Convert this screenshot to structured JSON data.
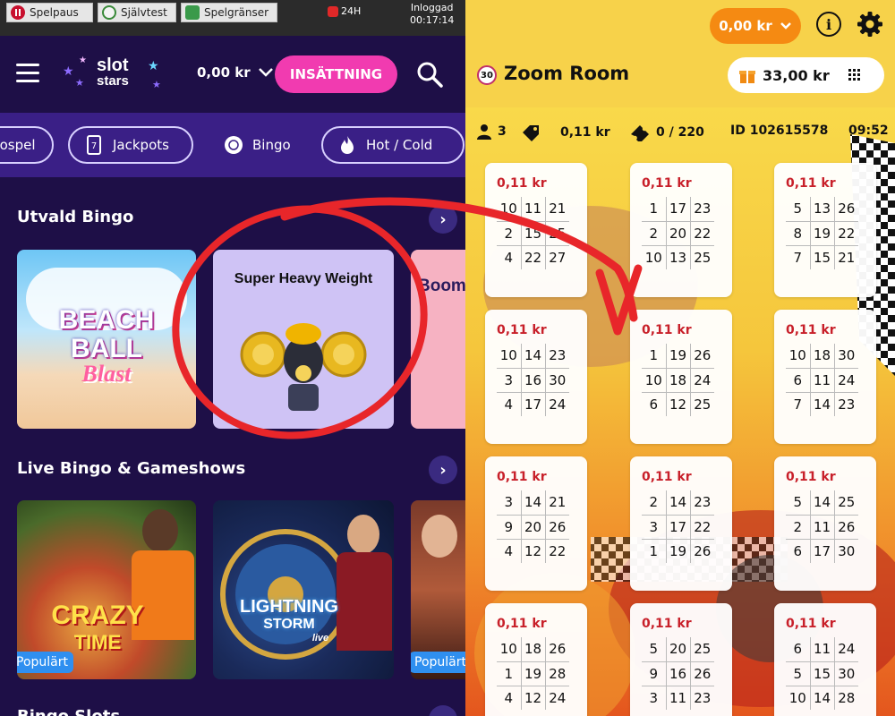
{
  "sysbar": {
    "pause_label": "Spelpaus",
    "selftest_label": "Självtest",
    "limits_label": "Spelgränser",
    "timer_label": "24H",
    "login_label": "Inloggad",
    "login_time": "00:17:14"
  },
  "header": {
    "logo_line1": "slot",
    "logo_line2": "stars",
    "balance": "0,00 kr",
    "deposit_label": "INSÄTTNING"
  },
  "categories": [
    {
      "label": "Gospel",
      "icon": "partial-chip"
    },
    {
      "label": "Jackpots",
      "icon": "jackpot-icon"
    },
    {
      "label": "Bingo",
      "icon": "bingo-ball-icon"
    },
    {
      "label": "Hot / Cold",
      "icon": "fire-icon"
    }
  ],
  "sections": {
    "featured_title": "Utvald Bingo",
    "live_title": "Live Bingo & Gameshows",
    "next_title": "Bingo Slots"
  },
  "featured_games": [
    {
      "title_line1": "BEACH",
      "title_line2": "BALL",
      "title_line3": "Blast"
    },
    {
      "title": "Super Heavy Weight"
    },
    {
      "title": "Boom Bingo"
    }
  ],
  "live_games": [
    {
      "title_line1": "CRAZY",
      "title_line2": "TIME",
      "badge": "Populärt"
    },
    {
      "title_line1": "LIGHTNING",
      "title_line2": "STORM",
      "title_line3": "live"
    },
    {
      "title": "",
      "badge": "Populärt"
    }
  ],
  "room": {
    "balance": "0,00 kr",
    "ball_number": "30",
    "title": "Zoom Room",
    "wallet": "33,00 kr",
    "players": "3",
    "ticket_price": "0,11 kr",
    "tickets": "0 / 220",
    "game_id": "ID  102615578",
    "time": "09:52"
  },
  "tickets": [
    {
      "price": "0,11 kr",
      "rows": [
        [
          "10",
          "11",
          "21"
        ],
        [
          "2",
          "15",
          "25"
        ],
        [
          "4",
          "22",
          "27"
        ]
      ]
    },
    {
      "price": "0,11 kr",
      "rows": [
        [
          "1",
          "17",
          "23"
        ],
        [
          "2",
          "20",
          "22"
        ],
        [
          "10",
          "13",
          "25"
        ]
      ]
    },
    {
      "price": "0,11 kr",
      "rows": [
        [
          "5",
          "13",
          "26"
        ],
        [
          "8",
          "19",
          "22"
        ],
        [
          "7",
          "15",
          "21"
        ]
      ]
    },
    {
      "price": "0,11 kr",
      "rows": [
        [
          "10",
          "14",
          "23"
        ],
        [
          "3",
          "16",
          "30"
        ],
        [
          "4",
          "17",
          "24"
        ]
      ]
    },
    {
      "price": "0,11 kr",
      "rows": [
        [
          "1",
          "19",
          "26"
        ],
        [
          "10",
          "18",
          "24"
        ],
        [
          "6",
          "12",
          "25"
        ]
      ]
    },
    {
      "price": "0,11 kr",
      "rows": [
        [
          "10",
          "18",
          "30"
        ],
        [
          "6",
          "11",
          "24"
        ],
        [
          "7",
          "14",
          "23"
        ]
      ]
    },
    {
      "price": "0,11 kr",
      "rows": [
        [
          "3",
          "14",
          "21"
        ],
        [
          "9",
          "20",
          "26"
        ],
        [
          "4",
          "12",
          "22"
        ]
      ]
    },
    {
      "price": "0,11 kr",
      "rows": [
        [
          "2",
          "14",
          "23"
        ],
        [
          "3",
          "17",
          "22"
        ],
        [
          "1",
          "19",
          "26"
        ]
      ]
    },
    {
      "price": "0,11 kr",
      "rows": [
        [
          "5",
          "14",
          "25"
        ],
        [
          "2",
          "11",
          "26"
        ],
        [
          "6",
          "17",
          "30"
        ]
      ]
    },
    {
      "price": "0,11 kr",
      "rows": [
        [
          "10",
          "18",
          "26"
        ],
        [
          "1",
          "19",
          "28"
        ],
        [
          "4",
          "12",
          "24"
        ]
      ]
    },
    {
      "price": "0,11 kr",
      "rows": [
        [
          "5",
          "20",
          "25"
        ],
        [
          "9",
          "16",
          "26"
        ],
        [
          "3",
          "11",
          "23"
        ]
      ]
    },
    {
      "price": "0,11 kr",
      "rows": [
        [
          "6",
          "11",
          "24"
        ],
        [
          "5",
          "15",
          "30"
        ],
        [
          "10",
          "14",
          "28"
        ]
      ]
    }
  ],
  "colors": {
    "left_bg": "#1e0f47",
    "category_bar": "#3a1f86",
    "deposit_pink": "#f13bb0",
    "room_yellow": "#f7d24a",
    "price_red": "#c8202a",
    "annotation_red": "#e8262a"
  }
}
